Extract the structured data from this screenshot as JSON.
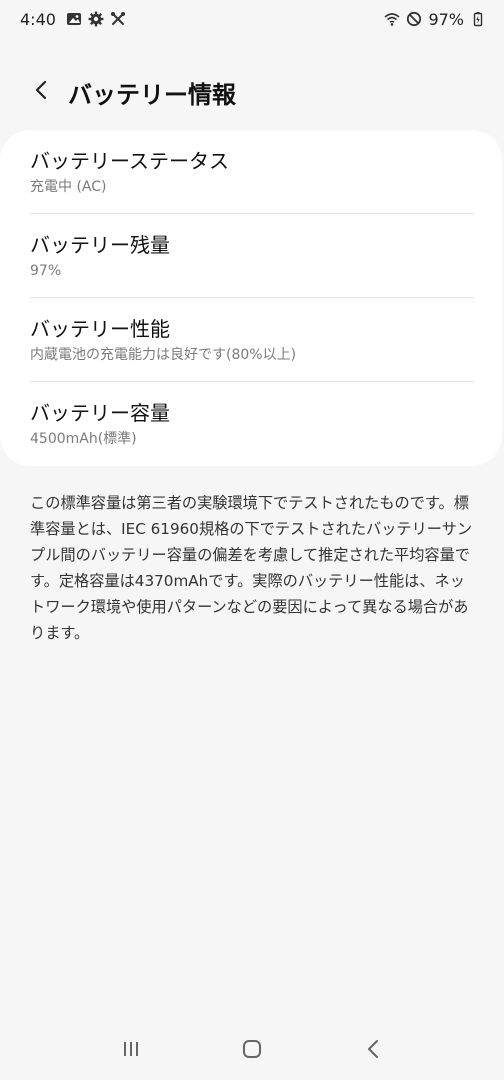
{
  "status_bar": {
    "time": "4:40",
    "battery_percent": "97%",
    "icons_left": [
      "gallery-icon",
      "settings-icon",
      "tools-icon"
    ],
    "icons_right": [
      "wifi-icon",
      "do-not-disturb-icon",
      "battery-charging-icon"
    ]
  },
  "header": {
    "title": "バッテリー情報",
    "back_icon": "back-arrow-icon"
  },
  "items": [
    {
      "title": "バッテリーステータス",
      "sub": "充電中 (AC)"
    },
    {
      "title": "バッテリー残量",
      "sub": "97%"
    },
    {
      "title": "バッテリー性能",
      "sub": "内蔵電池の充電能力は良好です(80%以上)"
    },
    {
      "title": "バッテリー容量",
      "sub": "4500mAh(標準)"
    }
  ],
  "note": "この標準容量は第三者の実験環境下でテストされたものです。標準容量とは、IEC 61960規格の下でテストされたバッテリーサンプル間のバッテリー容量の偏差を考慮して推定された平均容量です。定格容量は4370mAhです。実際のバッテリー性能は、ネットワーク環境や使用パターンなどの要因によって異なる場合があります。",
  "nav_bar": {
    "recent": "recent-apps-icon",
    "home": "home-icon",
    "back": "back-icon"
  },
  "colors": {
    "background": "#f6f6f6",
    "card": "#ffffff",
    "subtext": "#7b7b7b"
  }
}
